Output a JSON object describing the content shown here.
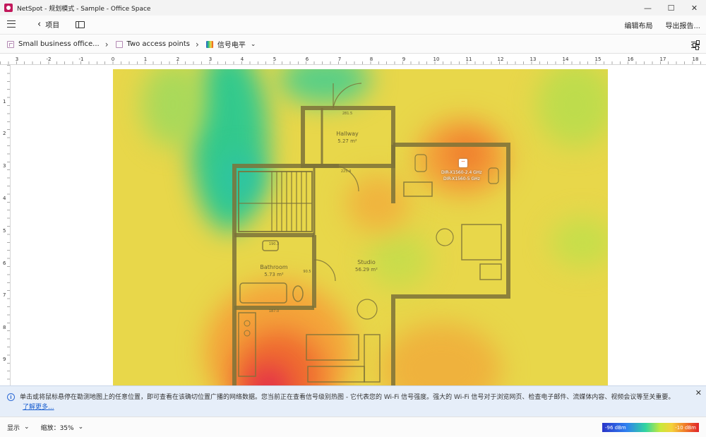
{
  "window": {
    "title": "NetSpot - 规划模式 - Sample - Office Space",
    "minimize": "—",
    "maximize": "☐",
    "close": "✕"
  },
  "toolbar": {
    "back_label": "项目",
    "edit_layout": "编辑布局",
    "export_report": "导出报告..."
  },
  "breadcrumb": {
    "items": [
      {
        "label": "Small business office..."
      },
      {
        "label": "Two access points"
      },
      {
        "label": "信号电平"
      }
    ]
  },
  "ruler": {
    "top": [
      "3",
      "-2",
      "-1",
      "0",
      "1",
      "2",
      "3",
      "4",
      "5",
      "6",
      "7",
      "8",
      "9",
      "10",
      "11",
      "12",
      "13",
      "14",
      "15",
      "16",
      "17",
      "18"
    ],
    "left": [
      "1",
      "2",
      "3",
      "4",
      "5",
      "6",
      "7",
      "8",
      "9"
    ]
  },
  "floorplan": {
    "rooms": [
      {
        "name": "Hallway",
        "area": "5.27 m²"
      },
      {
        "name": "Bathroom",
        "area": "5.73 m²"
      },
      {
        "name": "Studio",
        "area": "56.29 m²"
      }
    ],
    "access_points": [
      "DIR-X1560-2.4 GHz",
      "DIR-X1560-5 GHz"
    ],
    "dims": [
      "281.5",
      "190.3",
      "225.4",
      "90.5",
      "187.0"
    ]
  },
  "info_banner": {
    "text": "单击或将鼠标悬停在勘测地图上的任意位置，即可查看在该确切位置广播的网络数据。您当前正在查看信号级别热图 - 它代表您的 Wi-Fi 信号强度。强大的 Wi-Fi 信号对于浏览网页、检查电子邮件、流媒体内容、视频会议等至关重要。",
    "link": "了解更多..."
  },
  "statusbar": {
    "display_label": "显示",
    "zoom_label": "缩放：35%",
    "legend_min": "-96 dBm",
    "legend_max": "-10 dBm"
  },
  "colors": {
    "heat_base": "#e8d74a",
    "heat_strong": "#e0242a",
    "heat_weak": "#31d5a0",
    "accent": "#1a5fd0"
  }
}
